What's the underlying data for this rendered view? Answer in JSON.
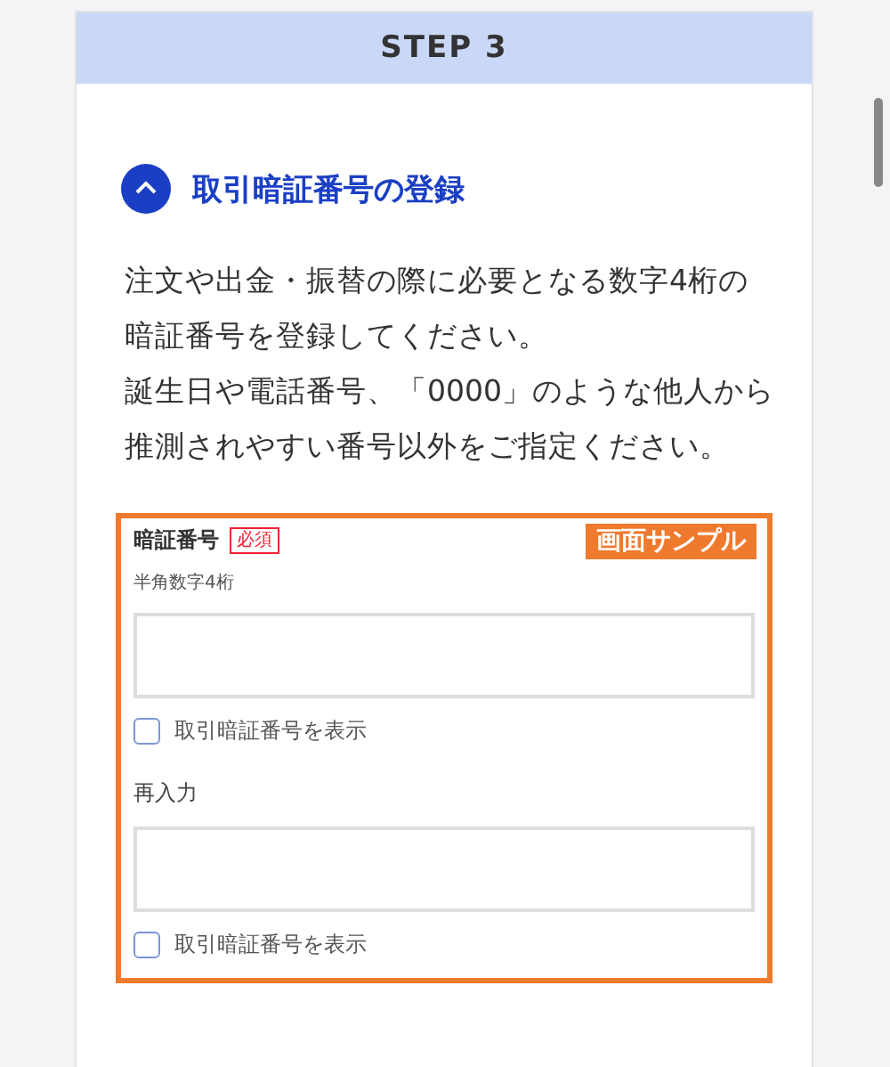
{
  "step_header": "STEP 3",
  "section": {
    "title": "取引暗証番号の登録",
    "expanded": true
  },
  "description": [
    "注文や出金・振替の際に必要となる数字4桁の暗証番号を登録してください。",
    "誕生日や電話番号、「0000」のような他人から推測されやすい番号以外をご指定ください。"
  ],
  "sample": {
    "badge": "画面サンプル",
    "fields": [
      {
        "label": "暗証番号",
        "required_badge": "必須",
        "hint": "半角数字4桁",
        "show_toggle": {
          "label": "取引暗証番号を表示",
          "checked": false
        }
      },
      {
        "label": "再入力",
        "show_toggle": {
          "label": "取引暗証番号を表示",
          "checked": false
        }
      }
    ]
  }
}
